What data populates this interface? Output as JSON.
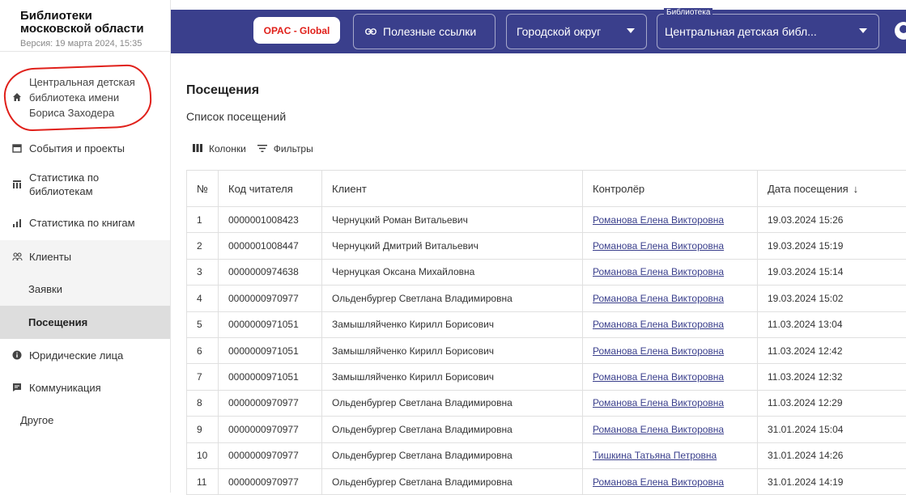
{
  "brand": {
    "title_line1": "Библиотеки",
    "title_line2": "московской области",
    "version": "Версия: 19 марта 2024, 15:35"
  },
  "sidebar": {
    "library": {
      "line1": "Центральная детская",
      "line2": "библиотека имени",
      "line3": "Бориса Заходера",
      "icon": "home-icon"
    },
    "items": [
      {
        "label": "События и проекты",
        "icon": "calendar-icon"
      },
      {
        "label_line1": "Статистика по",
        "label_line2": "библиотекам",
        "icon": "columns-chart-icon"
      },
      {
        "label": "Статистика по книгам",
        "icon": "bar-chart-icon"
      },
      {
        "label": "Клиенты",
        "icon": "people-icon"
      },
      {
        "label": "Заявки"
      },
      {
        "label": "Посещения",
        "active": true
      },
      {
        "label": "Юридические лица",
        "icon": "info-icon"
      },
      {
        "label": "Коммуникация",
        "icon": "chat-icon"
      },
      {
        "label": "Другое"
      }
    ]
  },
  "header": {
    "opac_label": "OPAC - Global",
    "links_label": "Полезные ссылки",
    "district_label": "Городской округ",
    "library_legend": "Библиотека",
    "library_value": "Центральная детская библ...",
    "accent": "#3a3f8c",
    "opac_color": "#e0201a"
  },
  "main": {
    "title": "Посещения",
    "subtitle": "Список посещений",
    "toolbar": {
      "columns_label": "Колонки",
      "filters_label": "Фильтры"
    }
  },
  "table": {
    "columns": [
      "№",
      "Код читателя",
      "Клиент",
      "Контролёр",
      "Дата посещения"
    ],
    "sort_indicator": "↓",
    "rows": [
      [
        "1",
        "0000001008423",
        "Чернуцкий Роман Витальевич",
        "Романова Елена Викторовна",
        "19.03.2024 15:26"
      ],
      [
        "2",
        "0000001008447",
        "Чернуцкий Дмитрий Витальевич",
        "Романова Елена Викторовна",
        "19.03.2024 15:19"
      ],
      [
        "3",
        "0000000974638",
        "Чернуцкая Оксана Михайловна",
        "Романова Елена Викторовна",
        "19.03.2024 15:14"
      ],
      [
        "4",
        "0000000970977",
        "Ольденбургер Светлана Владимировна",
        "Романова Елена Викторовна",
        "19.03.2024 15:02"
      ],
      [
        "5",
        "0000000971051",
        "Замышляйченко Кирилл Борисович",
        "Романова Елена Викторовна",
        "11.03.2024 13:04"
      ],
      [
        "6",
        "0000000971051",
        "Замышляйченко Кирилл Борисович",
        "Романова Елена Викторовна",
        "11.03.2024 12:42"
      ],
      [
        "7",
        "0000000971051",
        "Замышляйченко Кирилл Борисович",
        "Романова Елена Викторовна",
        "11.03.2024 12:32"
      ],
      [
        "8",
        "0000000970977",
        "Ольденбургер Светлана Владимировна",
        "Романова Елена Викторовна",
        "11.03.2024 12:29"
      ],
      [
        "9",
        "0000000970977",
        "Ольденбургер Светлана Владимировна",
        "Романова Елена Викторовна",
        "31.01.2024 15:04"
      ],
      [
        "10",
        "0000000970977",
        "Ольденбургер Светлана Владимировна",
        "Тишкина Татьяна Петровна",
        "31.01.2024 14:26"
      ],
      [
        "11",
        "0000000970977",
        "Ольденбургер Светлана Владимировна",
        "Романова Елена Викторовна",
        "31.01.2024 14:19"
      ]
    ]
  }
}
